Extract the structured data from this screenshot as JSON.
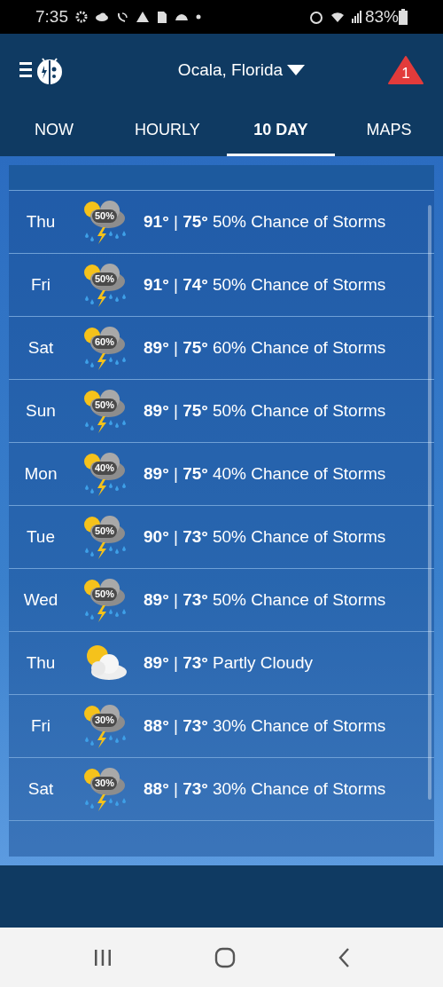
{
  "status_bar": {
    "time": "7:35",
    "battery": "83%"
  },
  "header": {
    "location": "Ocala, Florida",
    "alert_count": "1"
  },
  "tabs": [
    {
      "label": "NOW",
      "selected": false
    },
    {
      "label": "HOURLY",
      "selected": false
    },
    {
      "label": "10 DAY",
      "selected": true
    },
    {
      "label": "MAPS",
      "selected": false
    }
  ],
  "days": [
    {
      "day": "Thu",
      "kind": "storm",
      "pop": "50%",
      "temps": "**91°** | **75°**",
      "summary": "50% Chance of Storms"
    },
    {
      "day": "Fri",
      "kind": "storm",
      "pop": "50%",
      "temps": "**91°** | **74°**",
      "summary": "50% Chance of Storms"
    },
    {
      "day": "Sat",
      "kind": "storm",
      "pop": "60%",
      "temps": "**89°** | **75°**",
      "summary": "60% Chance of Storms"
    },
    {
      "day": "Sun",
      "kind": "storm",
      "pop": "50%",
      "temps": "**89°** | **75°**",
      "summary": "50% Chance of Storms"
    },
    {
      "day": "Mon",
      "kind": "storm",
      "pop": "40%",
      "temps": "**89°** | **75°**",
      "summary": "40% Chance of Storms"
    },
    {
      "day": "Tue",
      "kind": "storm",
      "pop": "50%",
      "temps": "**90°** | **73°**",
      "summary": "50% Chance of Storms"
    },
    {
      "day": "Wed",
      "kind": "storm",
      "pop": "50%",
      "temps": "**89°** | **73°**",
      "summary": "50% Chance of Storms"
    },
    {
      "day": "Thu",
      "kind": "partly_cloudy",
      "temps": "**89°** | **73°**",
      "summary": "Partly Cloudy"
    },
    {
      "day": "Fri",
      "kind": "storm",
      "pop": "30%",
      "temps": "**88°** | **73°**",
      "summary": "30% Chance of Storms"
    },
    {
      "day": "Sat",
      "kind": "storm",
      "pop": "30%",
      "temps": "**88°** | **73°**",
      "summary": "30% Chance of Storms"
    }
  ]
}
